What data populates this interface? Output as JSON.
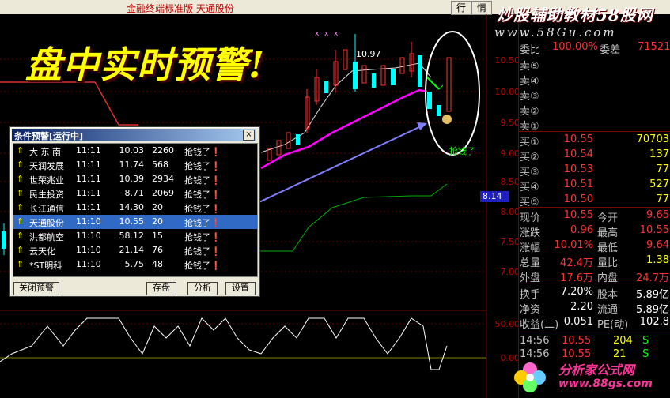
{
  "window": {
    "title": "金融终端标准版 天通股份",
    "btn_quote": "行",
    "btn_info": "情"
  },
  "chart": {
    "banner": "盘中实时预警!",
    "high_label": "10.97",
    "signal_label": "抢钱了",
    "current_price_tag": "8.14",
    "price_ticks": [
      "10.50",
      "10.00",
      "9.50",
      "9.00",
      "8.50",
      "8.00",
      "7.50",
      "7.00"
    ],
    "indicator_ticks": [
      "50.00",
      "0.00"
    ]
  },
  "alert_window": {
    "title": "条件预警[运行中]",
    "close": "×",
    "rows": [
      {
        "name": "大 东 南",
        "time": "11:11",
        "price": "10.03",
        "vol": "2260",
        "msg": "抢钱了❗"
      },
      {
        "name": "天润发展",
        "time": "11:11",
        "price": "11.74",
        "vol": "568",
        "msg": "抢钱了❗"
      },
      {
        "name": "世荣兆业",
        "time": "11:11",
        "price": "10.39",
        "vol": "2934",
        "msg": "抢钱了❗"
      },
      {
        "name": "民生投资",
        "time": "11:11",
        "price": "8.71",
        "vol": "2069",
        "msg": "抢钱了❗"
      },
      {
        "name": "长江通信",
        "time": "11:11",
        "price": "14.30",
        "vol": "20",
        "msg": "抢钱了❗"
      },
      {
        "name": "天通股份",
        "time": "11:10",
        "price": "10.55",
        "vol": "20",
        "msg": "抢钱了❗"
      },
      {
        "name": "洪都航空",
        "time": "11:10",
        "price": "58.12",
        "vol": "15",
        "msg": "抢钱了❗"
      },
      {
        "name": "云天化",
        "time": "11:10",
        "price": "21.14",
        "vol": "76",
        "msg": "抢钱了❗"
      },
      {
        "name": "*ST明科",
        "time": "11:10",
        "price": "5.75",
        "vol": "48",
        "msg": "抢钱了❗"
      }
    ],
    "selected_index": 5,
    "btn_close": "关闭预警",
    "btn_save": "存盘",
    "btn_analyze": "分析",
    "btn_settings": "设置"
  },
  "right_panel": {
    "logo_text": "炒股辅助教材58股网",
    "logo_url": "www.58Gu.com",
    "top_row": {
      "left": "委比",
      "left_val": "100.00%",
      "mid": "委差",
      "right_val": "71521"
    },
    "sell_levels": [
      "卖⑤",
      "卖④",
      "卖③",
      "卖②",
      "卖①"
    ],
    "buy_levels": [
      {
        "label": "买①",
        "price": "10.55",
        "vol": "70703"
      },
      {
        "label": "买②",
        "price": "10.54",
        "vol": "137"
      },
      {
        "label": "买③",
        "price": "10.53",
        "vol": "77"
      },
      {
        "label": "买④",
        "price": "10.51",
        "vol": "527"
      },
      {
        "label": "买⑤",
        "price": "10.50",
        "vol": "77"
      }
    ],
    "stats": [
      {
        "k1": "现价",
        "v1": "10.55",
        "k2": "今开",
        "v2": "9.65"
      },
      {
        "k1": "涨跌",
        "v1": "0.96",
        "k2": "最高",
        "v2": "10.55"
      },
      {
        "k1": "涨幅",
        "v1": "10.01%",
        "k2": "最低",
        "v2": "9.64"
      },
      {
        "k1": "总量",
        "v1": "42.4万",
        "k2": "量比",
        "v2": "1.38"
      },
      {
        "k1": "外盘",
        "v1": "17.6万",
        "k2": "内盘",
        "v2": "24.7万"
      }
    ],
    "finance": [
      {
        "k1": "换手",
        "v1": "7.20%",
        "k2": "股本",
        "v2": "5.89亿"
      },
      {
        "k1": "净资",
        "v1": "2.20",
        "k2": "流通",
        "v2": "5.89亿"
      },
      {
        "k1": "收益(二)",
        "v1": "0.051",
        "k2": "PE(动)",
        "v2": "102.8"
      }
    ],
    "ticks": [
      {
        "time": "14:56",
        "price": "10.55",
        "vol": "204",
        "flag": "S"
      },
      {
        "time": "14:56",
        "price": "10.55",
        "vol": "21",
        "flag": "S"
      }
    ],
    "logo2_name": "分析家公式网",
    "logo2_url": "www.88gs.com"
  },
  "colors": {
    "up": "#ff3232",
    "down": "#00ffff",
    "ma_magenta": "#ff00ff",
    "ma_green": "#00c000",
    "label_silver": "#c0c0c0"
  }
}
